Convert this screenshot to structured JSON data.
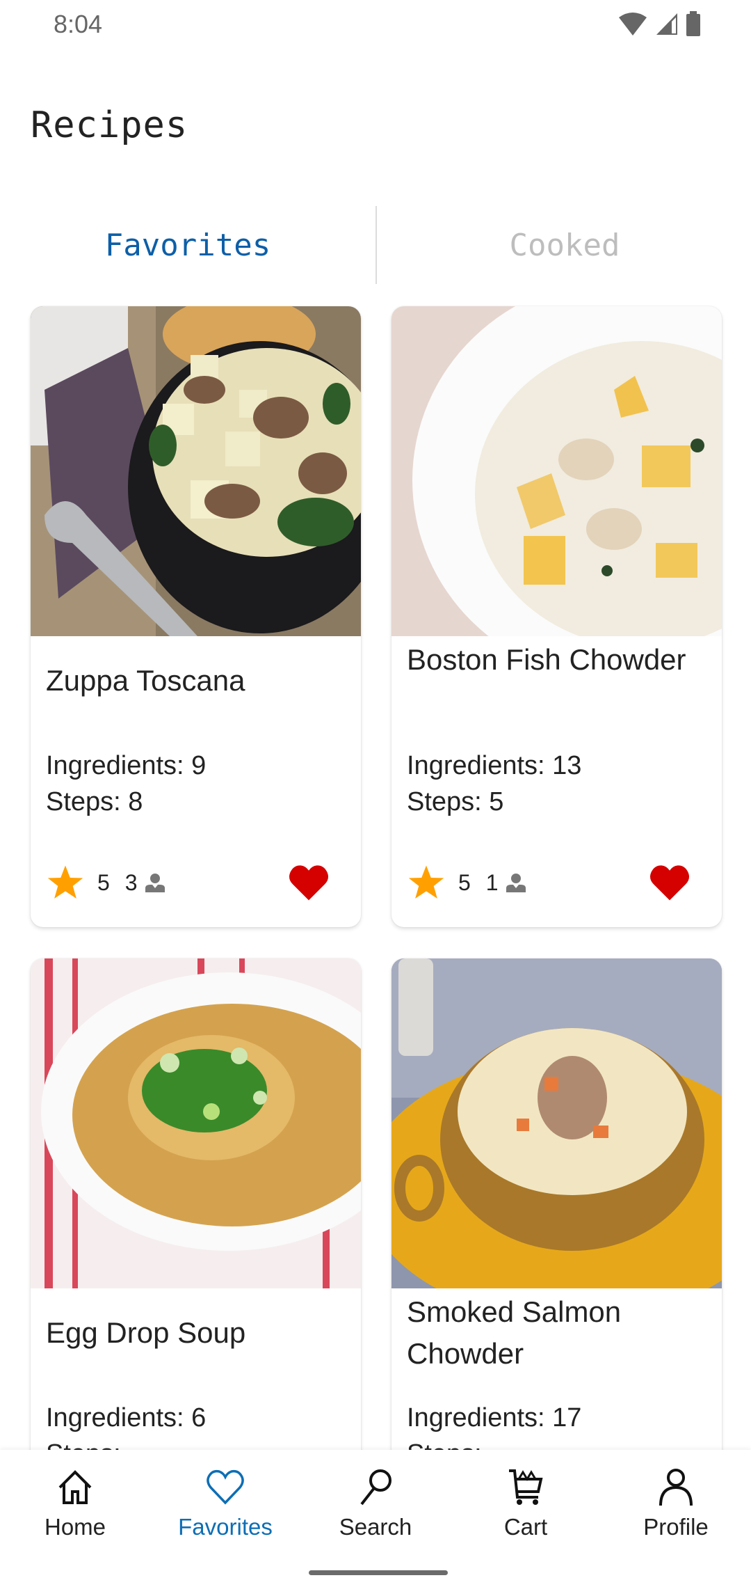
{
  "status_bar": {
    "time": "8:04",
    "icons": [
      "wifi-icon",
      "cell-signal-icon",
      "battery-icon"
    ]
  },
  "header": {
    "title": "Recipes"
  },
  "tabs": [
    {
      "label": "Favorites",
      "active": true
    },
    {
      "label": "Cooked",
      "active": false
    }
  ],
  "recipes": [
    {
      "title": "Zuppa Toscana",
      "ingredients": "Ingredients: 9",
      "steps": "Steps: 8",
      "rating": "5",
      "cooks": "3",
      "favorite": true,
      "image": "zuppa-toscana-photo"
    },
    {
      "title": "Boston Fish Chowder",
      "ingredients": "Ingredients: 13",
      "steps": "Steps: 5",
      "rating": "5",
      "cooks": "1",
      "favorite": true,
      "image": "fish-chowder-photo"
    },
    {
      "title": "Egg Drop Soup",
      "ingredients": "Ingredients: 6",
      "steps": "Steps:",
      "image": "egg-drop-soup-photo"
    },
    {
      "title": "Smoked Salmon Chowder",
      "ingredients": "Ingredients: 17",
      "steps": "Steps:",
      "image": "salmon-chowder-photo"
    }
  ],
  "bottom_nav": [
    {
      "label": "Home",
      "icon": "home-icon",
      "active": false
    },
    {
      "label": "Favorites",
      "icon": "heart-outline-icon",
      "active": true
    },
    {
      "label": "Search",
      "icon": "search-icon",
      "active": false
    },
    {
      "label": "Cart",
      "icon": "cart-icon",
      "active": false
    },
    {
      "label": "Profile",
      "icon": "profile-icon",
      "active": false
    }
  ],
  "colors": {
    "accent": "#0d6eb5",
    "tab_inactive": "#bdbdbd",
    "star": "#ffa000",
    "heart": "#d50000"
  }
}
